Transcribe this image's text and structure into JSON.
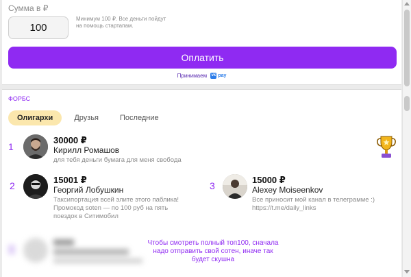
{
  "payment": {
    "amount_label": "Сумма в ₽",
    "amount_value": "100",
    "hint": "Минимум 100 ₽. Все деньги пойдут на помощь стартапам.",
    "pay_button": "Оплатить",
    "accept_text": "Принимаем",
    "accept_logo_letter": "vk",
    "accept_logo_word": "pay"
  },
  "leaderboard": {
    "title": "ФОРБС",
    "tabs": [
      {
        "label": "Олигархи",
        "active": true
      },
      {
        "label": "Друзья",
        "active": false
      },
      {
        "label": "Последние",
        "active": false
      }
    ],
    "entries": [
      {
        "rank": "1",
        "amount": "30000 ₽",
        "name": "Кирилл Ромашов",
        "note": "для тебя деньги бумага для меня свобода"
      },
      {
        "rank": "2",
        "amount": "15001 ₽",
        "name": "Георгий Лобушкин",
        "note": "Таксипортация всей элите этого паблика! Промокод soten — по 100 руб на пять поездок в Ситимобил"
      },
      {
        "rank": "3",
        "amount": "15000 ₽",
        "name": "Alexey Moiseenkov",
        "note": "Все приносит мой канал в телеграмме :) https://t.me/daily_links"
      }
    ],
    "locked_notice": "Чтобы смотреть полный топ100, сначала надо отправить свой сотен, иначе так будет скушна",
    "trophy_icon": "trophy-icon"
  },
  "colors": {
    "accent": "#8f2af2",
    "active_tab": "#fbe7ad",
    "muted_text": "#8b8b8b"
  }
}
